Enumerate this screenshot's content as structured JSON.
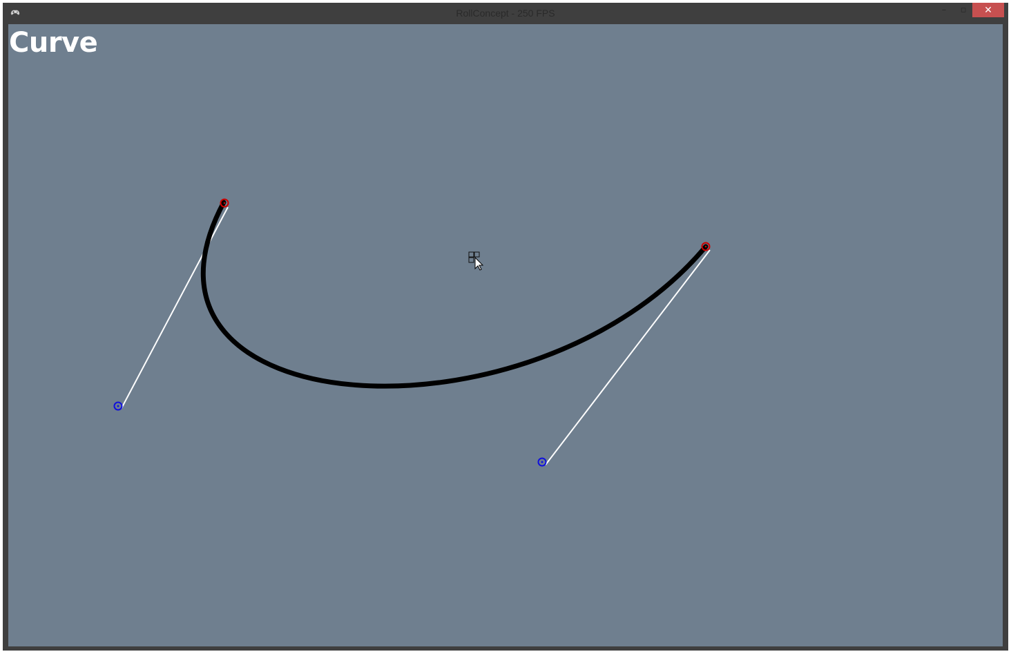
{
  "window": {
    "title": "RollConcept - 250 FPS",
    "app_icon": "gamepad-icon",
    "buttons": {
      "minimize_label": "–",
      "maximize_label": "▫",
      "close_label": "✕"
    }
  },
  "scene": {
    "title": "Curve",
    "background_color": "#6f7f8f",
    "curve_color": "#000000",
    "tangent_color": "#ffffff",
    "anchor_color": "#cc0000",
    "handle_color": "#1010dd",
    "cursor_icon": "pointer-with-grid-icon"
  }
}
